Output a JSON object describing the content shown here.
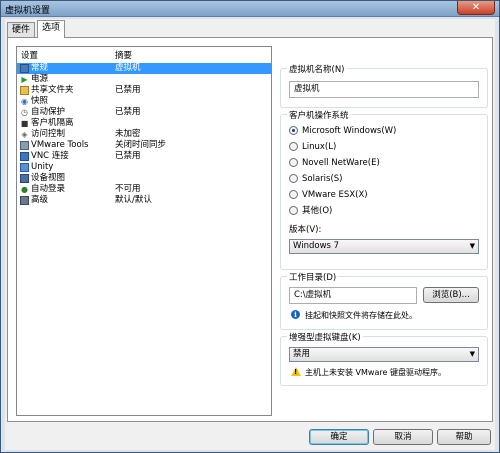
{
  "window": {
    "title": "虚拟机设置",
    "close_glyph": "✕"
  },
  "tabs": [
    {
      "label": "硬件"
    },
    {
      "label": "选项"
    }
  ],
  "list": {
    "header": {
      "setting": "设置",
      "summary": "摘要"
    },
    "items": [
      {
        "name": "常规",
        "summary": "虚拟机",
        "icon": "general-icon"
      },
      {
        "name": "电源",
        "summary": "",
        "icon": "power-icon"
      },
      {
        "name": "共享文件夹",
        "summary": "已禁用",
        "icon": "shared-folders-icon"
      },
      {
        "name": "快照",
        "summary": "",
        "icon": "snapshot-icon"
      },
      {
        "name": "自动保护",
        "summary": "已禁用",
        "icon": "autoprotect-icon"
      },
      {
        "name": "客户机隔离",
        "summary": "",
        "icon": "guest-isolation-icon"
      },
      {
        "name": "访问控制",
        "summary": "未加密",
        "icon": "access-control-icon"
      },
      {
        "name": "VMware Tools",
        "summary": "关闭时间同步",
        "icon": "vmware-tools-icon"
      },
      {
        "name": "VNC 连接",
        "summary": "已禁用",
        "icon": "vnc-icon"
      },
      {
        "name": "Unity",
        "summary": "",
        "icon": "unity-icon"
      },
      {
        "name": "设备视图",
        "summary": "",
        "icon": "device-view-icon"
      },
      {
        "name": "自动登录",
        "summary": "不可用",
        "icon": "autologin-icon"
      },
      {
        "name": "高级",
        "summary": "默认/默认",
        "icon": "advanced-icon"
      }
    ]
  },
  "vm_name": {
    "label": "虚拟机名称(N)",
    "value": "虚拟机"
  },
  "guest_os": {
    "label": "客户机操作系统",
    "options": [
      {
        "label": "Microsoft Windows(W)",
        "selected": true
      },
      {
        "label": "Linux(L)",
        "selected": false
      },
      {
        "label": "Novell NetWare(E)",
        "selected": false
      },
      {
        "label": "Solaris(S)",
        "selected": false
      },
      {
        "label": "VMware ESX(X)",
        "selected": false
      },
      {
        "label": "其他(O)",
        "selected": false
      }
    ],
    "version_label": "版本(V):",
    "version_value": "Windows 7"
  },
  "workdir": {
    "label": "工作目录(D)",
    "value": "C:\\虚拟机",
    "browse_label": "浏览(B)...",
    "note": "挂起和快照文件将存储在此处。"
  },
  "keyboard": {
    "label": "增强型虚拟键盘(K)",
    "value": "禁用",
    "warning": "主机上未安装 VMware 键盘驱动程序。"
  },
  "buttons": {
    "ok": "确定",
    "cancel": "取消",
    "help": "帮助"
  }
}
